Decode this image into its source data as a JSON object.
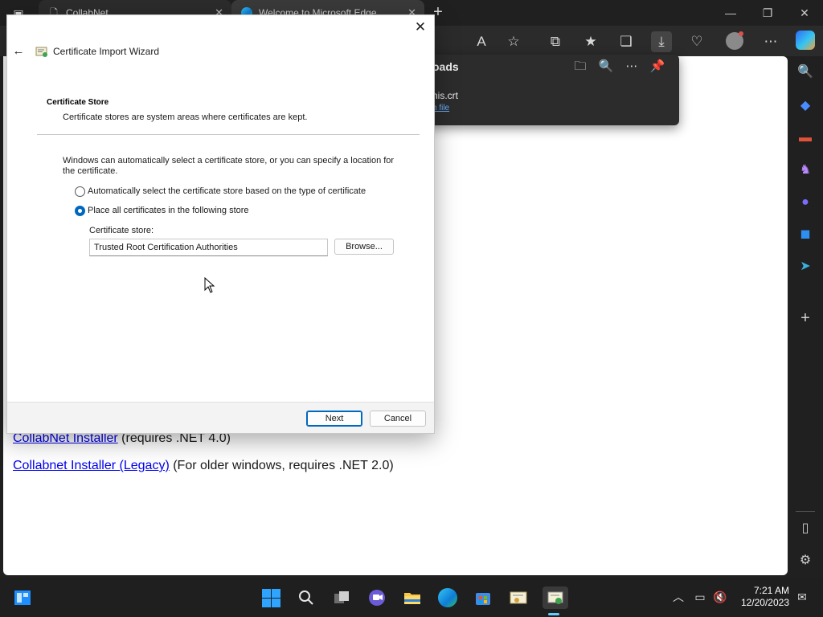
{
  "browser": {
    "tabs": [
      {
        "label": "CollabNet",
        "icon": "page-icon"
      },
      {
        "label": "Welcome to Microsoft Edge",
        "icon": "edge-icon"
      }
    ],
    "new_tab_glyph": "+",
    "window_controls": {
      "minimize": "—",
      "restore": "❐",
      "close": "✕"
    },
    "toolbar_icons": [
      "read-aloud-icon",
      "favorite-star-icon",
      "split-screen-icon",
      "favorites-icon",
      "collections-icon",
      "downloads-icon",
      "browser-essentials-icon",
      "profile-icon",
      "more-icon",
      "copilot-icon"
    ],
    "toolbar_glyphs": {
      "read_aloud": "A",
      "favorite": "☆",
      "split": "⧉",
      "favorites": "★",
      "collections": "❏",
      "downloads": "⤓",
      "essentials": "♡",
      "more": "⋯"
    }
  },
  "downloads_panel": {
    "title": "oads",
    "icons": {
      "folder": "🗀",
      "search": "🔍",
      "more": "⋯",
      "pin": "📌"
    },
    "file_name": "nis.crt",
    "open_file_label": "n file"
  },
  "page": {
    "links": [
      {
        "link_text": "CollabNet Installer",
        "suffix": " (requires .NET 4.0)"
      },
      {
        "link_text": "Collabnet Installer (Legacy)",
        "suffix": " (For older windows, requires .NET 2.0)"
      }
    ]
  },
  "sidebar": {
    "icons": [
      "search-icon",
      "shopping-tag-icon",
      "tools-icon",
      "games-icon",
      "office-icon",
      "outlook-icon",
      "send-icon",
      "add-icon",
      "sidebar-toggle-icon",
      "settings-icon"
    ],
    "glyphs": {
      "search": "🔍",
      "add": "+",
      "settings": "⚙",
      "panel": "▯"
    }
  },
  "wizard": {
    "title": "Certificate Import Wizard",
    "close_glyph": "✕",
    "back_glyph": "←",
    "heading": "Certificate Store",
    "subheading": "Certificate stores are system areas where certificates are kept.",
    "description": "Windows can automatically select a certificate store, or you can specify a location for the certificate.",
    "options": [
      {
        "label": "Automatically select the certificate store based on the type of certificate",
        "selected": false
      },
      {
        "label": "Place all certificates in the following store",
        "selected": true
      }
    ],
    "store_label": "Certificate store:",
    "store_value": "Trusted Root Certification Authorities",
    "browse_label": "Browse...",
    "next_label": "Next",
    "cancel_label": "Cancel"
  },
  "taskbar": {
    "apps": [
      "widgets-icon",
      "start-icon",
      "search-icon",
      "task-view-icon",
      "chat-icon",
      "file-explorer-icon",
      "edge-icon",
      "store-icon",
      "certificate-icon",
      "certificate-wizard-icon"
    ],
    "tray": [
      "chevron-up-icon",
      "network-icon",
      "volume-muted-icon",
      "notification-icon"
    ],
    "time": "7:21 AM",
    "date": "12/20/2023"
  }
}
